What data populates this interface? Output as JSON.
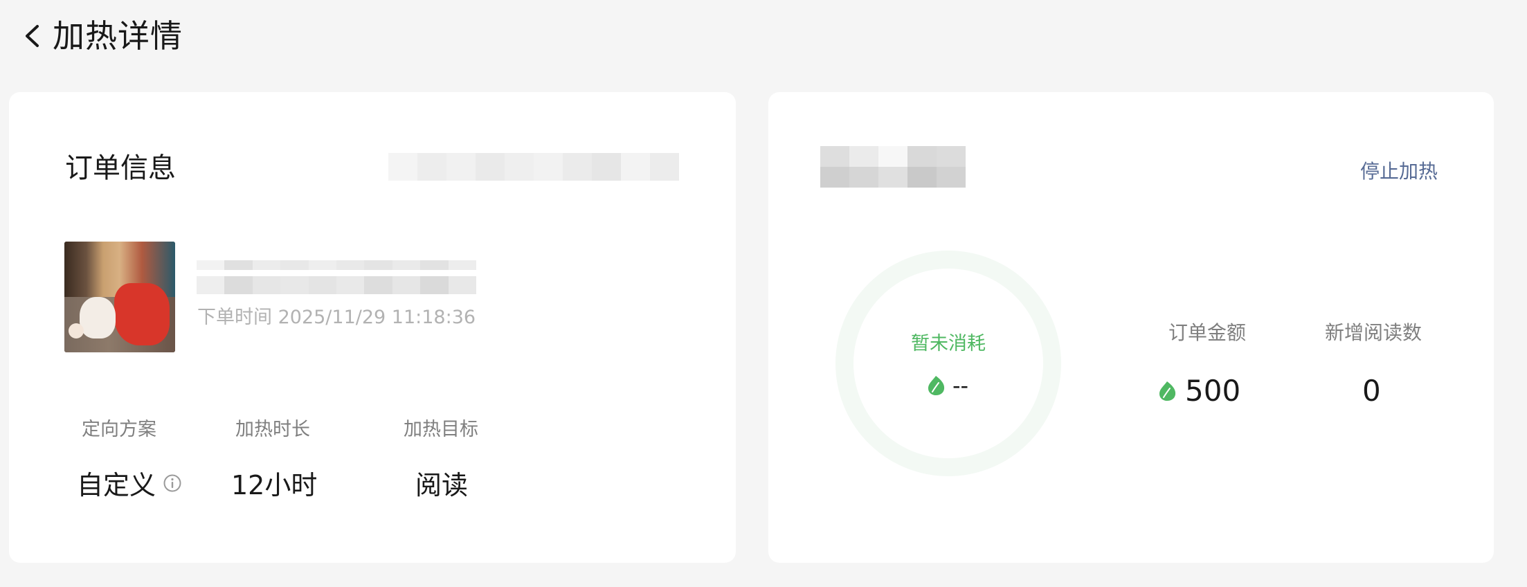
{
  "header": {
    "title": "加热详情",
    "back_icon": "chevron-left-icon"
  },
  "order_card": {
    "section_title": "订单信息",
    "order_time": "下单时间 2025/11/29 11:18:36",
    "stats": [
      {
        "label": "定向方案",
        "value": "自定义"
      },
      {
        "label": "加热时长",
        "value": "12小时"
      },
      {
        "label": "加热目标",
        "value": "阅读"
      }
    ]
  },
  "spend_card": {
    "stop_label": "停止加热",
    "ring": {
      "status_label": "暂未消耗",
      "value": "--"
    },
    "metrics": [
      {
        "label": "订单金额",
        "value": "500",
        "has_coin": true
      },
      {
        "label": "新增阅读数",
        "value": "0",
        "has_coin": false
      }
    ]
  },
  "colors": {
    "background": "#f5f5f5",
    "card": "#ffffff",
    "accent_green": "#4fb862",
    "link_blue": "#576b95",
    "muted_text": "#7f7f7f"
  }
}
